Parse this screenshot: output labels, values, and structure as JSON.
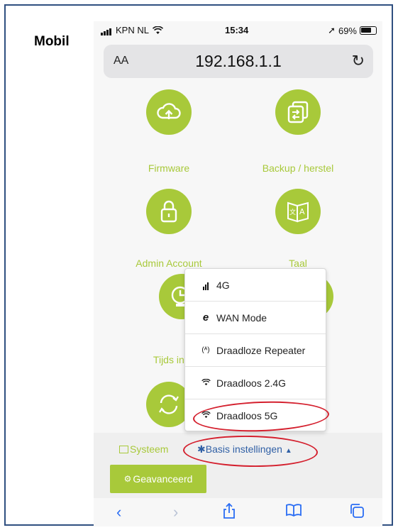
{
  "label": "Mobil",
  "status": {
    "carrier": "KPN NL",
    "time": "15:34",
    "battery": "69%"
  },
  "address": {
    "aa": "AA",
    "url": "192.168.1.1"
  },
  "tiles": {
    "firmware": "Firmware",
    "backup": "Backup / herstel",
    "admin": "Admin Account",
    "taal": "Taal",
    "tijds": "Tijds ingeste"
  },
  "menu": [
    {
      "label": "4G",
      "icon": "signal-bars-icon"
    },
    {
      "label": "WAN Mode",
      "icon": "ie-icon"
    },
    {
      "label": "Draadloze Repeater",
      "icon": "antenna-icon"
    },
    {
      "label": "Draadloos 2.4G",
      "icon": "wifi-icon"
    },
    {
      "label": "Draadloos 5G",
      "icon": "wifi-icon"
    }
  ],
  "tabs": {
    "system": "Systeem",
    "basis": "Basis instellingen",
    "advanced": "Geavanceerd"
  },
  "colors": {
    "accent": "#a8c93a",
    "link": "#2f5fa5",
    "highlight": "#d41f2d"
  }
}
